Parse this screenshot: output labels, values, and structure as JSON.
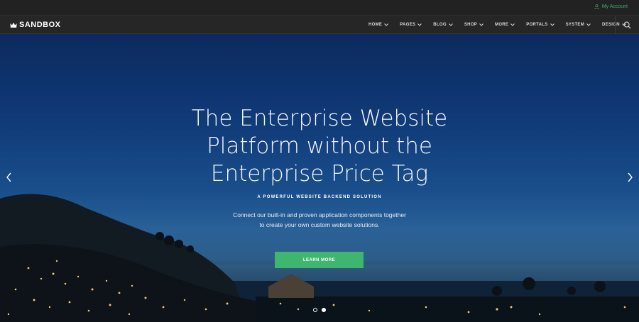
{
  "topbar": {
    "account_label": "My Account",
    "account_icon": "user-icon"
  },
  "brand": {
    "name": "SANDBOX",
    "icon": "crown-logo-icon"
  },
  "nav": {
    "items": [
      {
        "label": "HOME"
      },
      {
        "label": "PAGES"
      },
      {
        "label": "BLOG"
      },
      {
        "label": "SHOP"
      },
      {
        "label": "MORE"
      },
      {
        "label": "PORTALS"
      },
      {
        "label": "SYSTEM"
      },
      {
        "label": "DESIGN"
      }
    ],
    "search_icon": "search-icon"
  },
  "hero": {
    "headline": [
      "The Enterprise Website",
      "Platform without the",
      "Enterprise Price Tag"
    ],
    "kicker": "A POWERFUL WEBSITE BACKEND SOLUTION",
    "description": [
      "Connect our built-in and proven application components together",
      "to create your own custom website solutions."
    ],
    "cta_label": "LEARN MORE",
    "slides_total": 2,
    "slide_active": 1
  },
  "colors": {
    "accent": "#3fb66f",
    "account_link": "#4aa86a",
    "navbar": "#262626",
    "topbar": "#222222"
  }
}
